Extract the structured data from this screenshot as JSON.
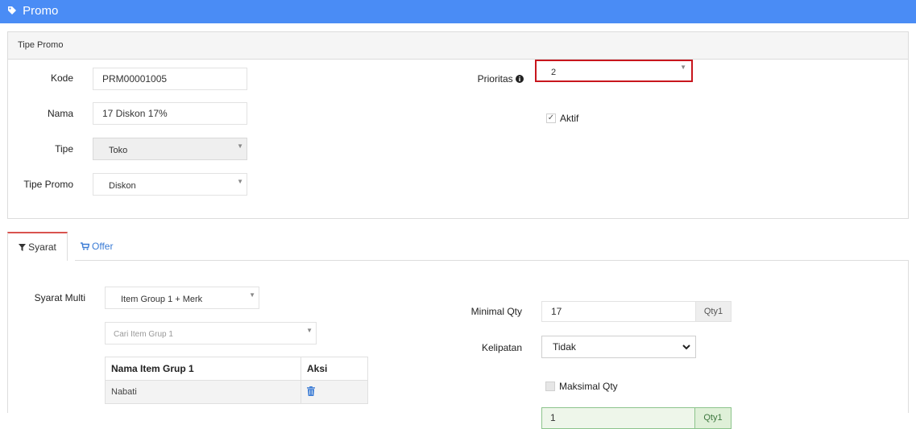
{
  "header": {
    "title": "Promo"
  },
  "panel": {
    "title": "Tipe Promo",
    "kode_label": "Kode",
    "kode_value": "PRM00001005",
    "nama_label": "Nama",
    "nama_value": "17 Diskon 17%",
    "tipe_label": "Tipe",
    "tipe_value": "Toko",
    "tipe_promo_label": "Tipe Promo",
    "tipe_promo_value": "Diskon",
    "prioritas_label": "Prioritas",
    "prioritas_value": "2",
    "aktif_label": "Aktif",
    "aktif_checked": true
  },
  "tabs": [
    {
      "label": "Syarat",
      "active": true
    },
    {
      "label": "Offer",
      "active": false
    }
  ],
  "syarat": {
    "syarat_multi_label": "Syarat Multi",
    "syarat_multi_value": "Item Group 1 + Merk",
    "cari_placeholder": "Cari Item Grup 1",
    "table_headers": [
      "Nama Item Grup 1",
      "Aksi"
    ],
    "table_rows": [
      {
        "nama": "Nabati"
      }
    ],
    "minimal_qty_label": "Minimal Qty",
    "minimal_qty_value": "17",
    "minimal_qty_addon": "Qty1",
    "kelipatan_label": "Kelipatan",
    "kelipatan_value": "Tidak",
    "maksimal_qty_label": "Maksimal Qty",
    "maksimal_qty_checked": false,
    "maksimal_qty_value": "1",
    "maksimal_qty_addon": "Qty1"
  },
  "colors": {
    "header_bg": "#4a8cf5",
    "highlight_border": "#c8161d",
    "tab_active_border": "#d9534f",
    "link": "#3a7bd5",
    "success_border": "#8cc48c"
  },
  "icons": {
    "header": "tag-icon",
    "info": "info-icon",
    "syarat_tab": "filter-icon",
    "offer_tab": "cart-icon",
    "delete": "trash-icon"
  }
}
